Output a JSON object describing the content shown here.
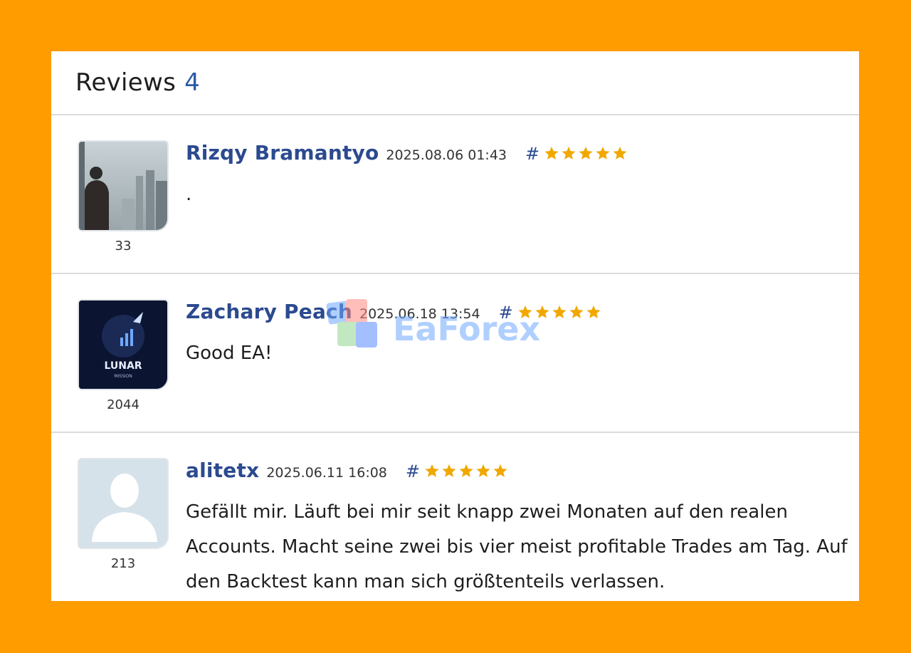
{
  "panel": {
    "title": "Reviews",
    "count": "4"
  },
  "reviews": [
    {
      "author": "Rizqy Bramantyo",
      "date": "2025.08.06 01:43",
      "hash": "#",
      "stars": 5,
      "text": ".",
      "rating_count": "33",
      "avatar": "photo-person-city-fog"
    },
    {
      "author": "Zachary Peach",
      "date": "2025.06.18 13:54",
      "hash": "#",
      "stars": 5,
      "text": "Good EA!",
      "rating_count": "2044",
      "avatar": "lunar-mission-logo",
      "avatar_text": [
        "LUNAR",
        "MISSION"
      ]
    },
    {
      "author": "alitetx",
      "date": "2025.06.11 16:08",
      "hash": "#",
      "stars": 5,
      "text": "Gefällt mir. Läuft bei mir seit knapp zwei Monaten auf den realen Accounts. Macht seine zwei bis vier meist profitable Trades am Tag. Auf den Backtest kann man sich größtenteils verlassen.",
      "rating_count": "213",
      "avatar": "default-user-silhouette"
    }
  ],
  "watermark": "EaForex",
  "colors": {
    "background": "#ff9c00",
    "author": "#2b4a8f",
    "count": "#2b5aa6",
    "star": "#f0a800"
  }
}
